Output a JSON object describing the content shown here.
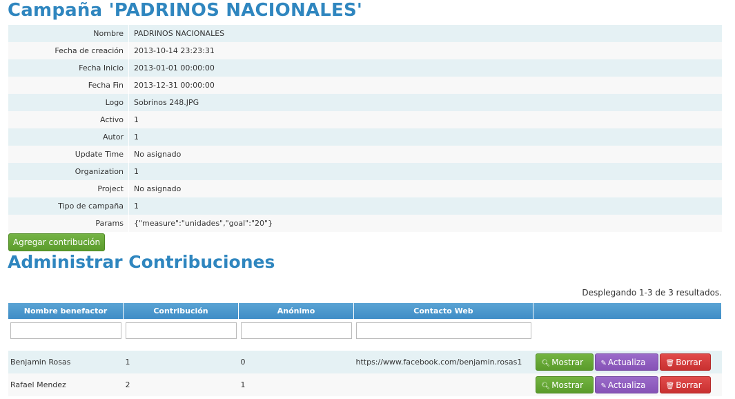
{
  "campaign": {
    "title": "Campaña 'PADRINOS NACIONALES'",
    "fields": [
      {
        "label": "Nombre",
        "value": "PADRINOS NACIONALES",
        "null": false
      },
      {
        "label": "Fecha de creación",
        "value": "2013-10-14 23:23:31",
        "null": false
      },
      {
        "label": "Fecha Inicio",
        "value": "2013-01-01 00:00:00",
        "null": false
      },
      {
        "label": "Fecha Fin",
        "value": "2013-12-31 00:00:00",
        "null": false
      },
      {
        "label": "Logo",
        "value": "Sobrinos 248.JPG",
        "null": false
      },
      {
        "label": "Activo",
        "value": "1",
        "null": false
      },
      {
        "label": "Autor",
        "value": "1",
        "null": false
      },
      {
        "label": "Update Time",
        "value": "No asignado",
        "null": true
      },
      {
        "label": "Organization",
        "value": "1",
        "null": false
      },
      {
        "label": "Project",
        "value": "No asignado",
        "null": true
      },
      {
        "label": "Tipo de campaña",
        "value": "1",
        "null": false
      },
      {
        "label": "Params",
        "value": "{\"measure\":\"unidades\",\"goal\":\"20\"}",
        "null": false
      }
    ],
    "add_button": "Agregar contribución"
  },
  "contributions": {
    "title": "Administrar Contribuciones",
    "summary": "Desplegando 1-3 de 3 resultados.",
    "columns": [
      "Nombre benefactor",
      "Contribución",
      "Anónimo",
      "Contacto Web"
    ],
    "rows": [
      {
        "benefactor": "Benjamin Rosas",
        "contribution": "1",
        "anonymous": "0",
        "web": "https://www.facebook.com/benjamin.rosas1"
      },
      {
        "benefactor": "Rafael Mendez",
        "contribution": "2",
        "anonymous": "1",
        "web": ""
      }
    ],
    "actions": {
      "show": "Mostrar",
      "update": "Actualiza",
      "delete": "Borrar"
    }
  },
  "colors": {
    "accent": "#2f86bf",
    "success": "#5a9b2b",
    "purple": "#8652b6",
    "danger": "#c83030",
    "null_text": "#f4a6b2"
  }
}
